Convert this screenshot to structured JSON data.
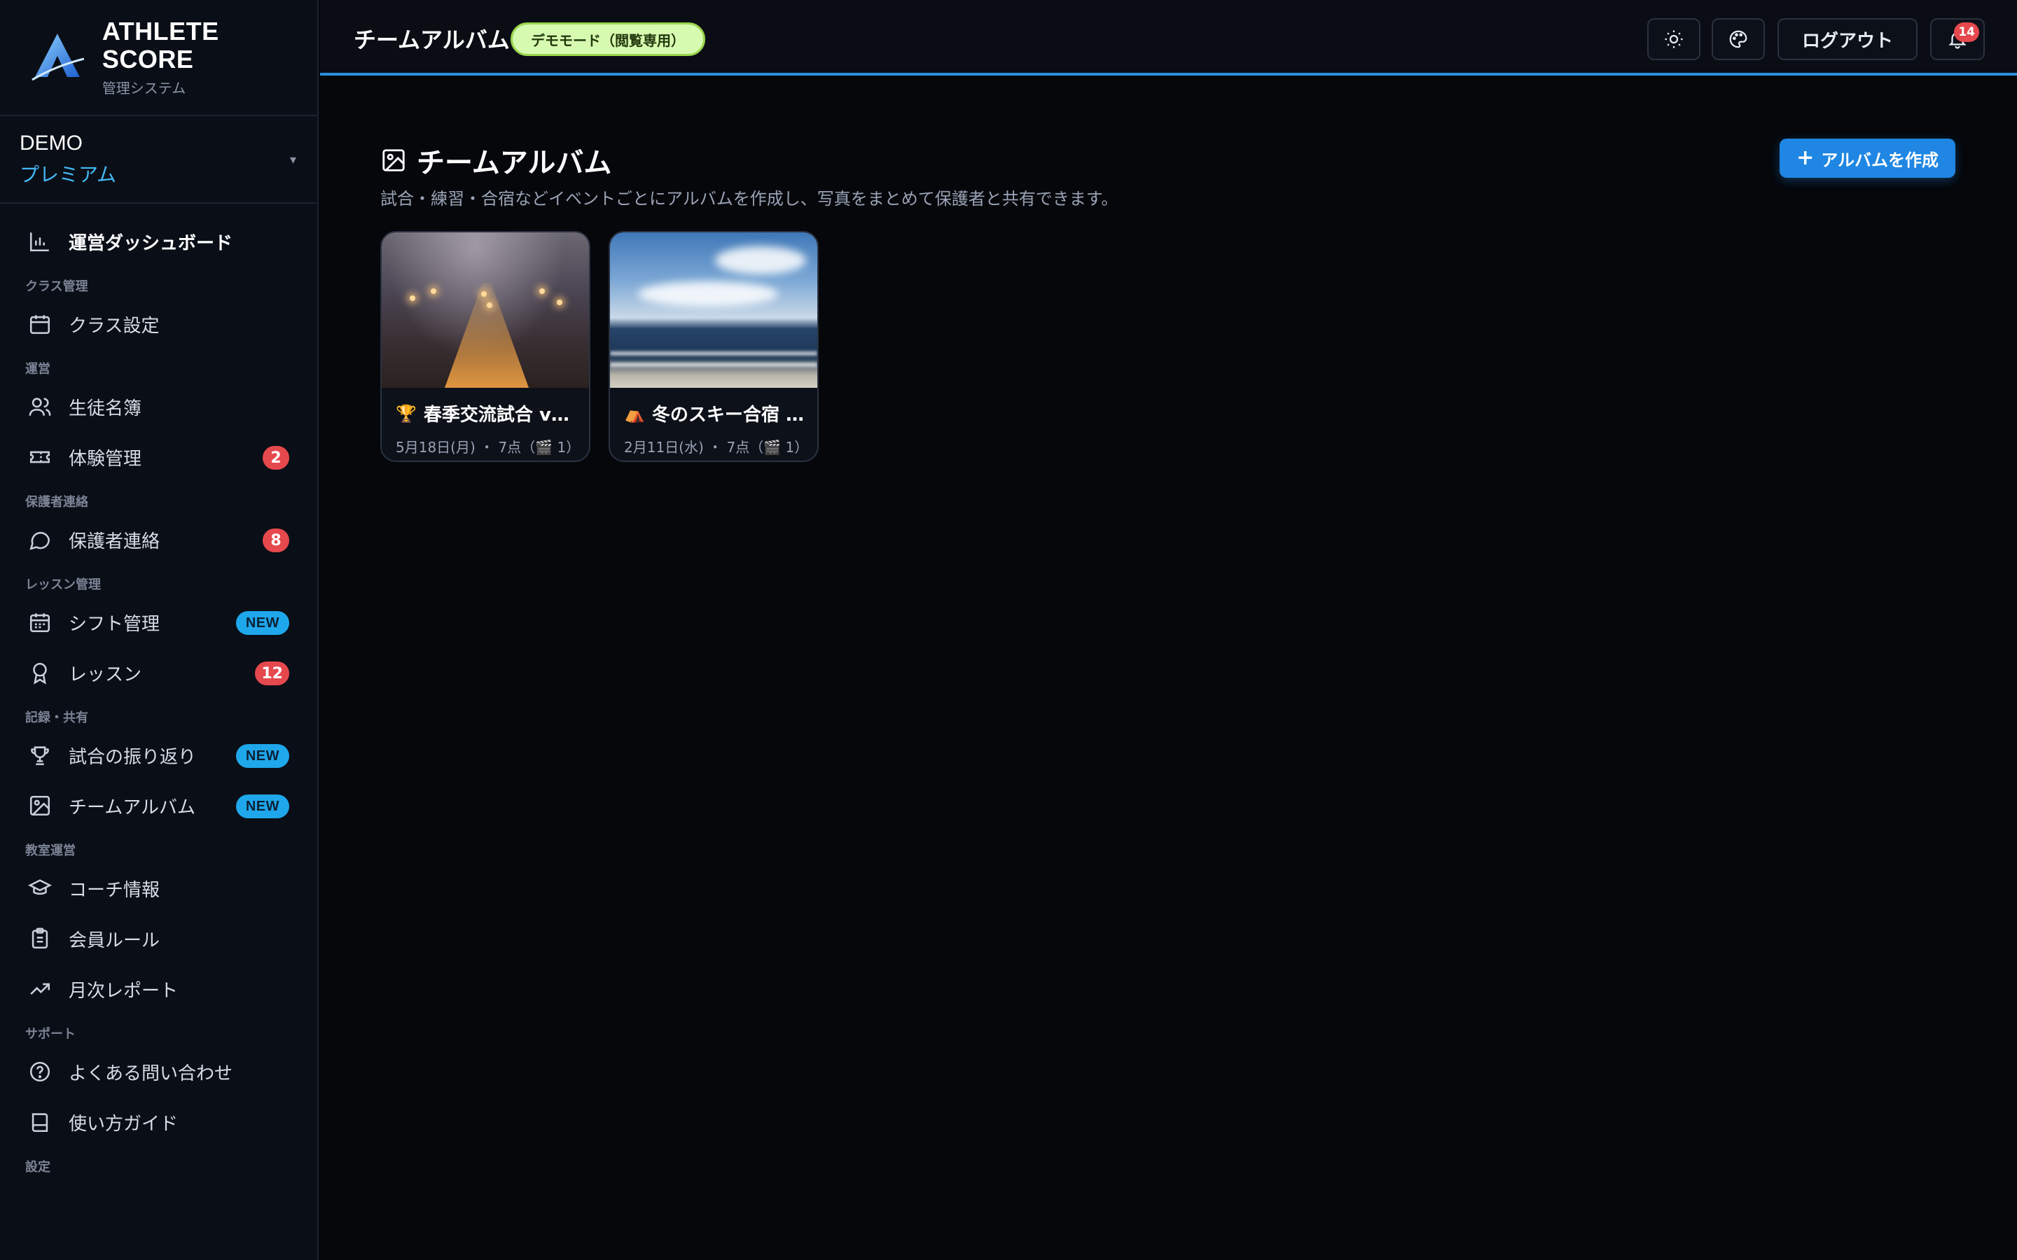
{
  "brand": {
    "title": "ATHLETE SCORE",
    "subtitle": "管理システム"
  },
  "plan": {
    "name": "DEMO",
    "tier": "プレミアム",
    "caret": "▾"
  },
  "sidebar": {
    "dashboard": "運営ダッシュボード",
    "sections": {
      "class": "クラス管理",
      "ops": "運営",
      "parents": "保護者連絡",
      "lesson": "レッスン管理",
      "records": "記録・共有",
      "school": "教室運営",
      "support": "サポート",
      "settings": "設定"
    },
    "items": {
      "class_settings": "クラス設定",
      "students": "生徒名簿",
      "trial": "体験管理",
      "trial_badge": "2",
      "parent_contact": "保護者連絡",
      "parent_badge": "8",
      "shift": "シフト管理",
      "shift_badge": "NEW",
      "lesson": "レッスン",
      "lesson_badge": "12",
      "match_review": "試合の振り返り",
      "match_badge": "NEW",
      "team_album": "チームアルバム",
      "album_badge": "NEW",
      "coach": "コーチ情報",
      "rules": "会員ルール",
      "report": "月次レポート",
      "faq": "よくある問い合わせ",
      "guide": "使い方ガイド"
    }
  },
  "topbar": {
    "title": "チームアルバム",
    "demo_badge": "デモモード（閲覧専用）",
    "logout": "ログアウト",
    "notif_count": "14"
  },
  "main": {
    "title": "チームアルバム",
    "description": "試合・練習・合宿などイベントごとにアルバムを作成し、写真をまとめて保護者と共有できます。",
    "create_button": "アルバムを作成",
    "create_plus": "+"
  },
  "albums": [
    {
      "emoji": "🏆",
      "title": "春季交流試合 v…",
      "meta": "5月18日(月) ・ 7点（🎬 1）"
    },
    {
      "emoji": "⛺",
      "title": "冬のスキー合宿 …",
      "meta": "2月11日(水) ・ 7点（🎬 1）"
    }
  ],
  "colors": {
    "accent": "#1f86e3",
    "badge_red": "#e5484d",
    "badge_new": "#1fa7ec",
    "demo_bg": "#d7fab1"
  }
}
